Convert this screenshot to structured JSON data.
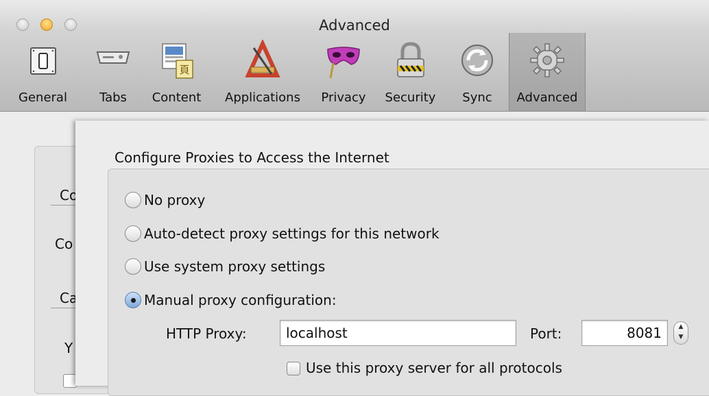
{
  "window": {
    "title": "Advanced",
    "accent_color": "#f0a52b"
  },
  "toolbar": {
    "items": [
      {
        "label": "General",
        "icon": "general-switch-icon"
      },
      {
        "label": "Tabs",
        "icon": "tabs-icon"
      },
      {
        "label": "Content",
        "icon": "content-icon"
      },
      {
        "label": "Applications",
        "icon": "applications-icon"
      },
      {
        "label": "Privacy",
        "icon": "privacy-mask-icon"
      },
      {
        "label": "Security",
        "icon": "lock-icon"
      },
      {
        "label": "Sync",
        "icon": "sync-icon"
      },
      {
        "label": "Advanced",
        "icon": "gear-icon"
      }
    ],
    "selected": "Advanced"
  },
  "background_pane": {
    "fragments": [
      "Co",
      "Co",
      "Ca",
      "Y"
    ]
  },
  "dialog": {
    "group_title": "Configure Proxies to Access the Internet",
    "options": [
      {
        "label": "No proxy",
        "checked": false
      },
      {
        "label": "Auto-detect proxy settings for this network",
        "checked": false
      },
      {
        "label": "Use system proxy settings",
        "checked": false
      },
      {
        "label": "Manual proxy configuration:",
        "checked": true
      }
    ],
    "http_proxy": {
      "label": "HTTP Proxy:",
      "value": "localhost",
      "port_label": "Port:",
      "port_value": "8081"
    },
    "all_protocols": {
      "label": "Use this proxy server for all protocols",
      "checked": false
    }
  }
}
